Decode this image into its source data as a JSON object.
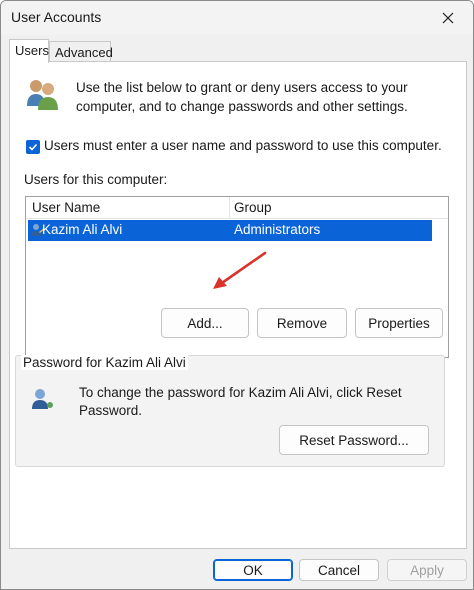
{
  "window": {
    "title": "User Accounts"
  },
  "tabs": [
    {
      "label": "Users"
    },
    {
      "label": "Advanced"
    }
  ],
  "intro": {
    "text": "Use the list below to grant or deny users access to your computer, and to change passwords and other settings."
  },
  "require_login": {
    "label": "Users must enter a user name and password to use this computer.",
    "checked": true
  },
  "users_list": {
    "label": "Users for this computer:",
    "columns": [
      "User Name",
      "Group"
    ],
    "rows": [
      {
        "name": "Kazim Ali Alvi",
        "group": "Administrators",
        "selected": true
      }
    ]
  },
  "list_buttons": {
    "add": "Add...",
    "remove": "Remove",
    "properties": "Properties"
  },
  "password": {
    "title": "Password for Kazim Ali Alvi",
    "text": "To change the password for Kazim Ali Alvi, click Reset Password.",
    "reset_button": "Reset Password..."
  },
  "footer": {
    "ok": "OK",
    "cancel": "Cancel",
    "apply": "Apply"
  },
  "colors": {
    "accent": "#0a64d8",
    "annotation_arrow": "#d9342b"
  },
  "icons": {
    "close": "close-icon",
    "users": "users-icon",
    "user": "user-icon",
    "password": "password-user-icon"
  }
}
